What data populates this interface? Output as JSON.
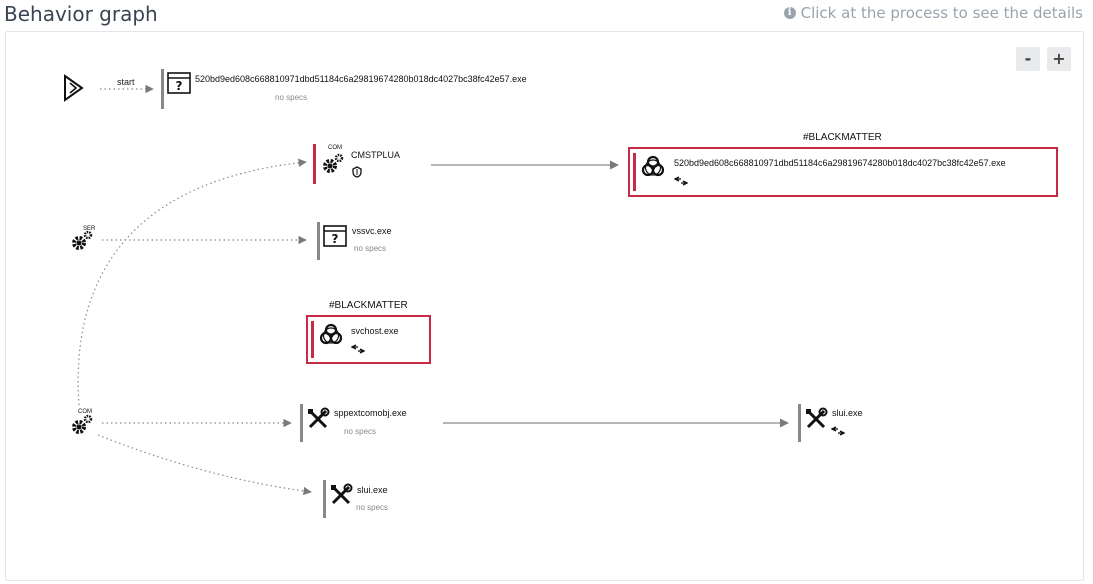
{
  "header": {
    "title": "Behavior graph",
    "hint": "Click at the process to see the details"
  },
  "zoom": {
    "minus": "-",
    "plus": "+"
  },
  "edge_labels": {
    "start": "start"
  },
  "sources": {
    "ser_label": "SER",
    "com_label": "COM"
  },
  "nodes": {
    "root": {
      "name": "520bd9ed608c668810971dbd51184c6a29819674280b018dc4027bc38fc42e57.exe",
      "specs": "no specs"
    },
    "cmstplua": {
      "name": "CMSTPLUA",
      "badge": "COM"
    },
    "mal_root": {
      "tag": "#BLACKMATTER",
      "name": "520bd9ed608c668810971dbd51184c6a29819674280b018dc4027bc38fc42e57.exe"
    },
    "vssvc": {
      "name": "vssvc.exe",
      "specs": "no specs"
    },
    "svchost": {
      "tag": "#BLACKMATTER",
      "name": "svchost.exe"
    },
    "sppext": {
      "name": "sppextcomobj.exe",
      "specs": "no specs"
    },
    "slui_right": {
      "name": "slui.exe"
    },
    "slui_bottom": {
      "name": "slui.exe",
      "specs": "no specs"
    }
  },
  "colors": {
    "malicious": "#c62a47",
    "neutral_bar": "#888888",
    "edge": "#8a8a8a"
  }
}
